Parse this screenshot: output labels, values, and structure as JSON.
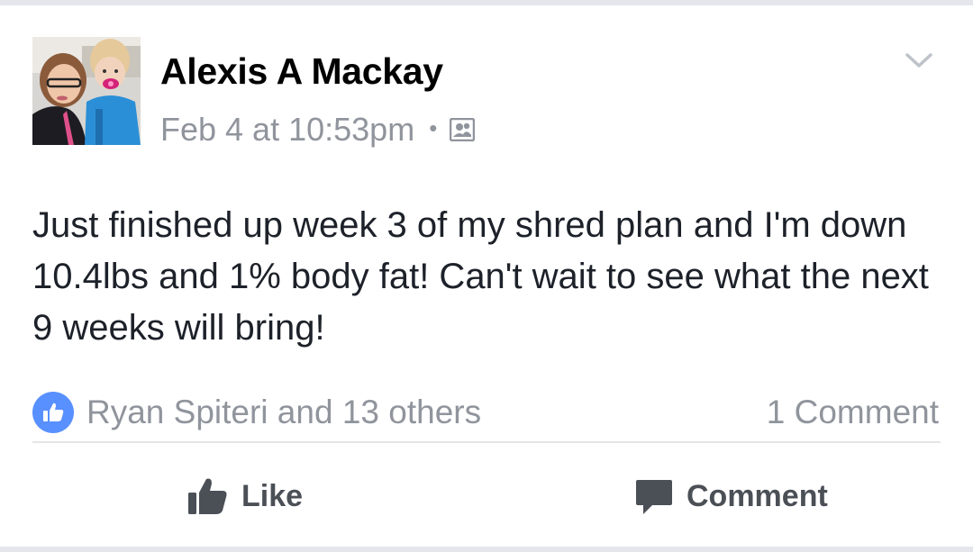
{
  "post": {
    "author": "Alexis A Mackay",
    "timestamp": "Feb 4 at 10:53pm",
    "separator": "•",
    "audience_icon": "friends-icon",
    "text": "Just finished up week 3 of my shred plan and I'm down 10.4lbs and 1% body fat! Can't wait to see what the next 9 weeks will bring!"
  },
  "reactions": {
    "icon": "thumbs-up-icon",
    "summary": "Ryan Spiteri and 13 others"
  },
  "comments": {
    "count_label": "1 Comment"
  },
  "actions": {
    "like_label": "Like",
    "comment_label": "Comment"
  },
  "colors": {
    "accent": "#5890ff",
    "meta_text": "#90949c",
    "action_text": "#4b4f56",
    "divider": "#e5e5e5"
  }
}
